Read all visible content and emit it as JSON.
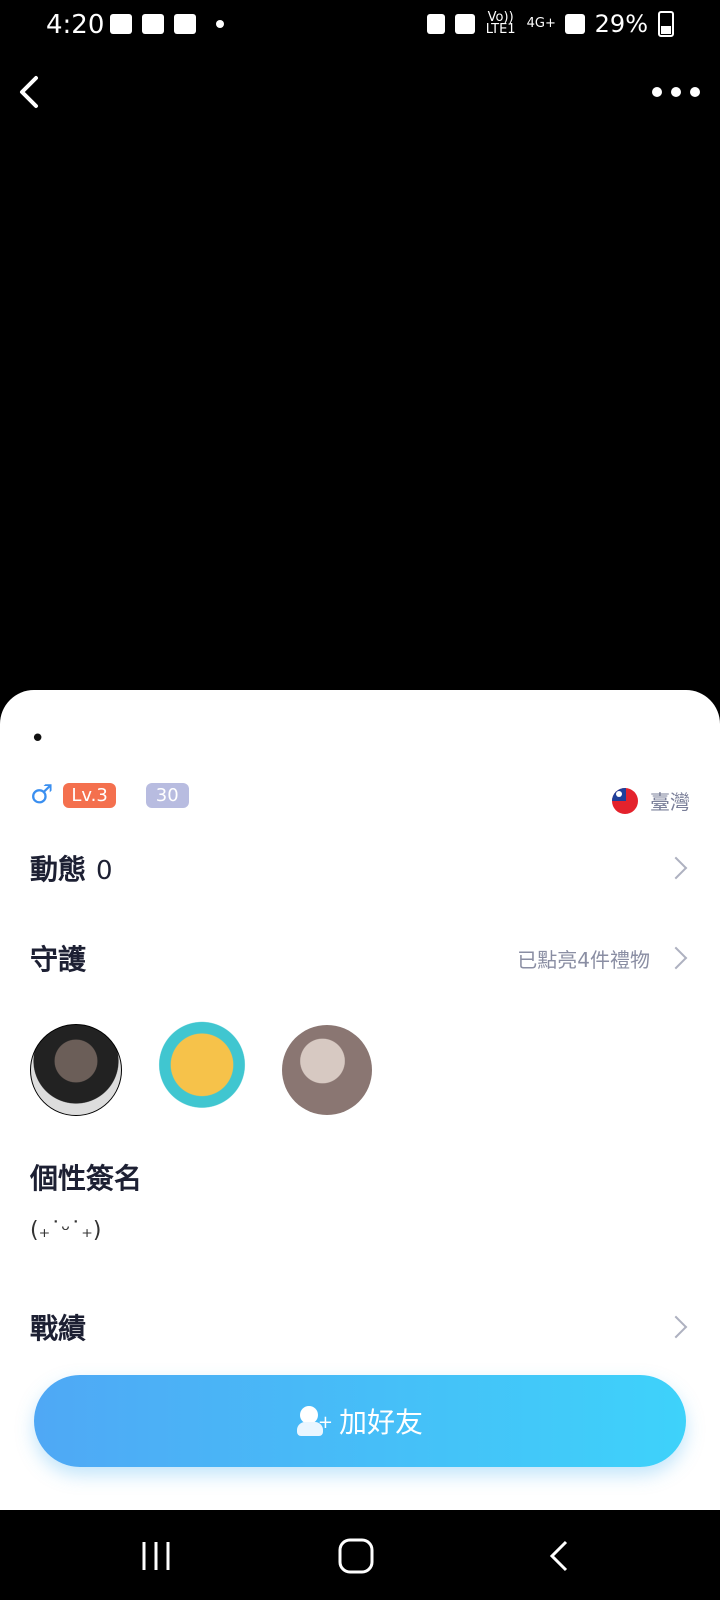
{
  "status_bar": {
    "time": "4:20",
    "battery": "29%",
    "network_top": "4G+",
    "lte": "Vo)) LTE1"
  },
  "profile": {
    "name": "•",
    "level": "Lv.3",
    "badge_number": "30",
    "region": "臺灣"
  },
  "moments": {
    "label": "動態",
    "count": "0"
  },
  "guardian": {
    "label": "守護",
    "right_text": "已點亮4件禮物"
  },
  "signature": {
    "label": "個性簽名",
    "text": "(₊˙ᵕ˙₊)"
  },
  "records": {
    "label": "戰績"
  },
  "actions": {
    "add_friend": "加好友"
  },
  "icons": [
    "back-icon",
    "more-icon",
    "male-icon",
    "flag-icon",
    "chevron-right-icon",
    "add-friend-icon",
    "recent-apps-icon",
    "home-icon",
    "nav-back-icon"
  ]
}
